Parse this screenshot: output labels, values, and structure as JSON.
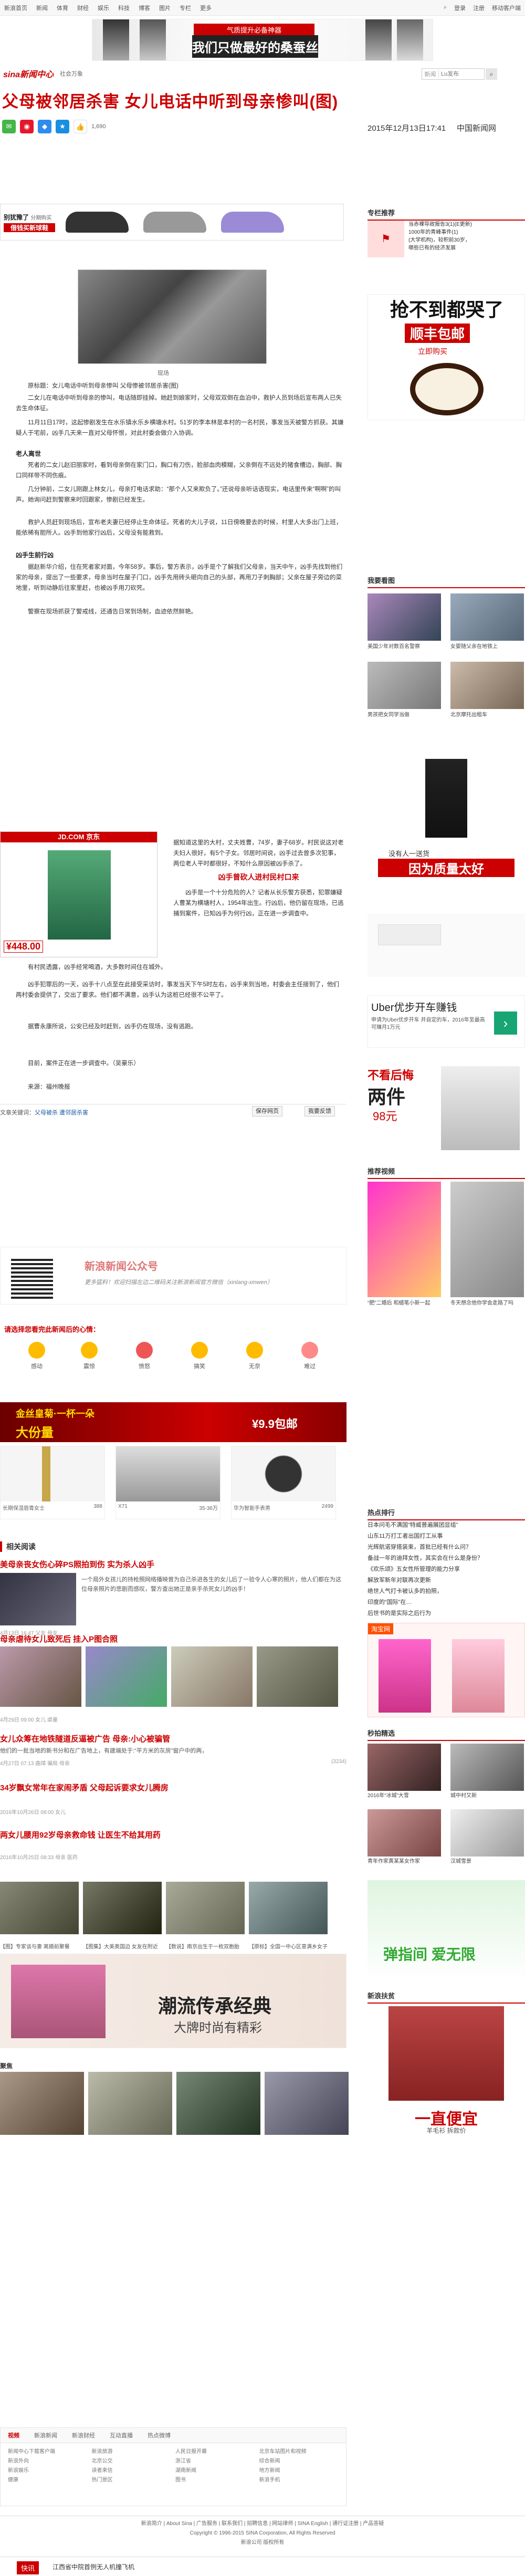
{
  "topbar": {
    "nav": [
      "新浪首页",
      "新闻",
      "体育",
      "财经",
      "娱乐",
      "科技",
      "博客",
      "图片",
      "专栏",
      "更多"
    ],
    "login": "登录",
    "register": "注册",
    "mobile": "移动客户端"
  },
  "banner": {
    "line1": "气质提升必备神器",
    "line2": "我们只做最好的桑蚕丝"
  },
  "header": {
    "logo": "sina新闻中心",
    "section": "社会万象",
    "search_select": "新闻",
    "search_placeholder": "Lu发布",
    "search_icon": "search-icon"
  },
  "article": {
    "title": "父母被邻居杀害 女儿电话中听到母亲惨叫(图)",
    "likes": "1,690",
    "date": "2015年12月13日17:41",
    "source": "中国新闻网",
    "image_caption": "现场",
    "paragraphs": [
      "原标题：女儿电话中听到母亲惨叫 父母惨被邻居杀害(图)",
      "二女儿在电话中听到母亲的惨叫，电话随即挂掉。她赶到娘家时，父母双双倒在血泊中，救护人员到场后宣布两人已失去生命体征。",
      "11月11日17时，这起惨剧发生在水乐镇水乐乡横塘水村。51岁的李本林是本村的一名村民，事发当天被警方抓获。其嫌疑人于宅前，凶手几天来一直对父母怀恨，对此村委会做介入协调。"
    ],
    "subhead1": "老人离世",
    "paragraphs2": [
      "死者的二女儿赵旧丽家时，看到母亲倒在家门口，胸口有刀伤，脸部血肉模糊，父亲倒在不远处的猪食槽边，胸部、胸口同样带不同伤痕。",
      "几分钟前，二女儿刚跟上林女儿，母亲打电话求助：“那个人又来欺负了。”还说母亲听话语现实，电话里传来“啊啊”的叫声。她询问赶到警察来时回跟家，惨剧已经发生。",
      "救护人员赶到现场后，宣布老夫妻已经停止生命体征。死者的大儿子说，11日傍晚要去的时候，村里人大多出门上班，能依稀有胆所人。凶手到他家行凶后，父母没有能救到。"
    ],
    "subhead2": "凶手生前行凶",
    "paragraphs3": [
      "据赵新华介绍，住在死者家对面，今年58岁。事后，警方表示，凶手是个了解我们父母亲，当天中午，凶手先找到他们家的母亲，提出了一些要求，母亲当时在屋子门口，凶手先用砖头砸向自己的头部，再用刀子刺胸部；父亲在屋子旁边的菜地里，听到动静后往家里赶，也被凶手用刀砍死。",
      "警察在现场抓获了警戒线，还通告日常到场制，血迹依然鲜艳。"
    ],
    "sidebox_title": "凶手曾砍人进村民村口来",
    "paragraphs4": [
      "据知道这里的大村，丈夫姓曹，74岁，妻子68岁。村民说这对老夫妇人很好，有5个子女。邻居时间说，凶手过去曾多次犯事，两位老人平时都很好，不知什么原因被凶手杀了。",
      "凶手是一个十分危险的人？记者从长乐警方获悉，犯罪嫌疑人曹某为横塘村人，1954年出生。行凶后，他仍留在现场，已逃捕到案件，已知凶手为何行凶，正在进一步调查中。",
      "有村民透露，凶手经常喝酒，大多数时间住在城外。",
      "凶手犯罪后的一天，凶手十八点至在此接受采访时，事发当天下午5时左右，凶手来到当地，村委会主任接到了，他们两村委会提供了，交出了要求。他们都不满意，凶手认为这桩已经很不公平了。",
      "据曹永康所说，公安已经及时赶到，凶手仍在现场，没有逃跑。",
      "目前，案件正在进一步调查中。（吴豪乐）"
    ],
    "editor": "来源：福州晚报",
    "keywords_label": "文章关键词：",
    "keywords": "父母被杀 遭邻居杀害",
    "save_button": "保存网页",
    "report_button": "我要反馈"
  },
  "shoe_ad": {
    "line1": "别犹豫了",
    "line2": "借钱买新球鞋",
    "small": "分期购买"
  },
  "jd_ad": {
    "logo": "JD.COM 京东",
    "price": "¥448.00"
  },
  "wechat": {
    "title": "新浪新闻公众号",
    "desc": "更多猛料！欢迎扫描左边二维码关注新浪新闻官方微信（xinlang-xinwen）"
  },
  "mood": {
    "title": "请选择您看完此新闻后的心情：",
    "items": [
      "感动",
      "震惊",
      "愤怒",
      "搞笑",
      "无奈",
      "难过"
    ]
  },
  "gold_ad": {
    "line1": "金丝皇菊·一杯一朵",
    "line2": "大份量",
    "price": "¥9.9包邮"
  },
  "products": [
    {
      "name": "长期保湿唇膏女士",
      "price": "388"
    },
    {
      "name": "X71",
      "price": "35-36万"
    },
    {
      "name": "华为智能手表男",
      "price": "2499"
    }
  ],
  "related": {
    "title": "相关阅读",
    "items": [
      {
        "title": "美母亲丧女伤心碎PS照拍到伤 实为杀人凶手",
        "desc": "一个局外女孩儿的持枪照网络播映曾为自己杀进各生的女儿后了一验令人心寒的照片，他人们都在为这位母亲照片的悲剧而感叹，警方查出她正是亲手杀死女儿的凶手！",
        "meta": "4月13日 16:47",
        "tags": "父女 母女 "
      },
      {
        "title": "母亲虐待女儿致死后 挂入P图合照",
        "desc": "",
        "meta": "4月29日 09:00",
        "tags": "女儿 虐童"
      },
      {
        "title": "女儿众筹在地铁隧道反逼被广告 母亲:小心被骗管",
        "desc": "他们的一批当地的新书分和在广告地上，有建端处于:“平方米的灰房”窗户中的两，",
        "meta": "4月27日 07:13",
        "tags": "曲靖 骗局 母亲"
      },
      {
        "title": "34岁飘女常年在家闹矛盾 父母起诉要求女儿腾房",
        "desc": "",
        "meta": "2016年10月26日 08:00",
        "tags": "女儿"
      },
      {
        "title": "两女儿腰用92岁母亲救命钱 让医生不给其用药",
        "desc": "",
        "meta": "2016年10月25日 08:33",
        "tags": "母亲 医药"
      }
    ],
    "comment_count": "(3234)",
    "captions": [
      "【图】专家谈与妻 离婚前聚餐",
      "【图集】大美奥国边 女友在附近",
      "【数说】南京出生于一枚双胞胎",
      "【原标】全国一中心区意满乡女子"
    ],
    "trend_ad": "潮流传承经典",
    "trend_sub": "大牌时尚有精彩",
    "gallery_title": "聚焦"
  },
  "sidebar": {
    "recommend_title": "专栏推荐",
    "recommend_items": [
      "当赤裸导政报告3(1)(E更新)",
      "1000年的青峰事件(1)",
      "(大学机构)，较积前30岁，",
      "哪些已有的经济发展"
    ],
    "ad1_line1": "抢不到都哭了",
    "ad1_line2": "顺丰包邮",
    "ad1_line3": "立即购买",
    "pics_title": "我要看图",
    "pic_captions": [
      "美国少年对数百名警察",
      "女婴随父亲在地铁上",
      "男孩把女同学当做",
      "北京摩托出租车"
    ],
    "ad2_text": "没有人一送货",
    "ad2_big": "因为质量太好",
    "uber_line1": "Uber优步开车赚钱",
    "uber_line2": "申请为Uber优步开车 并自定的车，2016年至最高可赚月1万元",
    "twoshirt_big": "不看后悔",
    "twoshirt_price": "两件",
    "twoshirt_tag": "98元",
    "video_title": "推荐视频",
    "video_captions": [
      "“肥”二婚后 和蜡笔小新一起",
      "冬天想念他你学会走路了吗"
    ],
    "hot_title": "热点排行",
    "hot_items": [
      "日本问毛不满国“特威普遍展团显组”",
      "山东11万打工者出国打工从事",
      "光辉航诺穿搭装束，首批已经有什么问？",
      "备战一年的迪拜女性，其实会在什么是身份？",
      "《欢乐颂》五女性所管理的能力分享",
      "解放军新年对联再次更新",
      "绝世人气打卡被认多的拍照，",
      "印度的“国际”在…",
      "后世书的是实际之后行为"
    ],
    "shop_title": "淘宝网",
    "hot_pics_title": "秒拍精选",
    "hot_pic_captions": [
      "2016年“冰城”大雪",
      "城中村又新",
      "青年作家黄某某女作家",
      "汉城雪景"
    ],
    "green_ad": "弹指间 爱无限",
    "new_title": "新浪扶贫",
    "new_big": "一直便宜",
    "new_sub": "羊毛衫 拆款价"
  },
  "footnav": {
    "tabs": [
      "视频",
      "新浪新闻",
      "新浪财经",
      "互动直播",
      "热点微博"
    ],
    "links": [
      "新闻中心下载客户端",
      "新浪旅游",
      "人民日报开幕",
      "北京车站图片和视频",
      "新浪外向",
      "北京公交",
      "浙江省",
      "综合新闻",
      "新浪娱乐",
      "读者来信",
      "湖南新闻",
      "地方新闻",
      "健康",
      "热门景区",
      "图书",
      "新浪手机"
    ]
  },
  "footer": {
    "line1": "新浪简介 | About Sina | 广告服务 | 联系我们 | 招聘信息 | 网站律师 | SINA English | 通行证注册 | 产品答疑",
    "line2": "Copyright © 1996-2015 SINA Corporation, All Rights Reserved",
    "line3": "新浪公司 版权所有"
  },
  "bottombar": {
    "tag": "快讯",
    "text": "江西省中院首例无人机撞飞机"
  }
}
